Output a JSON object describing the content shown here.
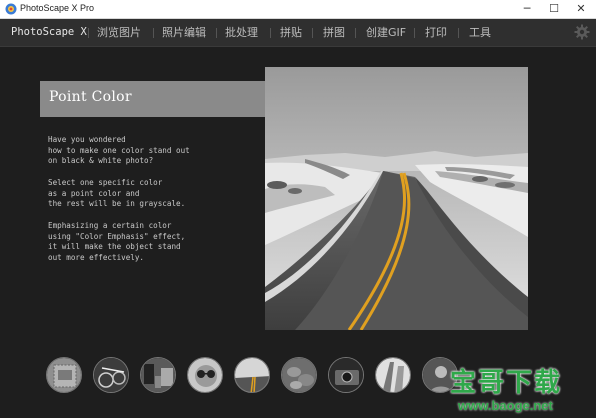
{
  "window": {
    "title": "PhotoScape X Pro",
    "minimize": "─",
    "maximize": "☐",
    "close": "✕"
  },
  "menu": {
    "brand": "PhotoScape X",
    "items": [
      "浏览图片",
      "照片编辑",
      "批处理",
      "拼贴",
      "拼图",
      "创建GIF",
      "打印",
      "工具"
    ]
  },
  "hero": {
    "title": "Point Color",
    "paragraphs": [
      [
        "Have you wondered",
        "how to make one color stand out",
        "on black & white photo?"
      ],
      [
        "Select one specific color",
        "as a point color and",
        "the rest will be in grayscale."
      ],
      [
        "Emphasizing a certain color",
        "using \"Color Emphasis\" effect,",
        "it will make the object stand",
        "out more effectively."
      ]
    ]
  },
  "thumbnails": [
    "stamp",
    "bikes",
    "street",
    "sunglasses",
    "road",
    "stones",
    "camera",
    "building",
    "person"
  ],
  "watermark": {
    "main": "宝哥下载",
    "url": "www.baoge.net"
  },
  "colors": {
    "accent_yellow": "#e0a020",
    "watermark_green": "#2fa84a"
  }
}
